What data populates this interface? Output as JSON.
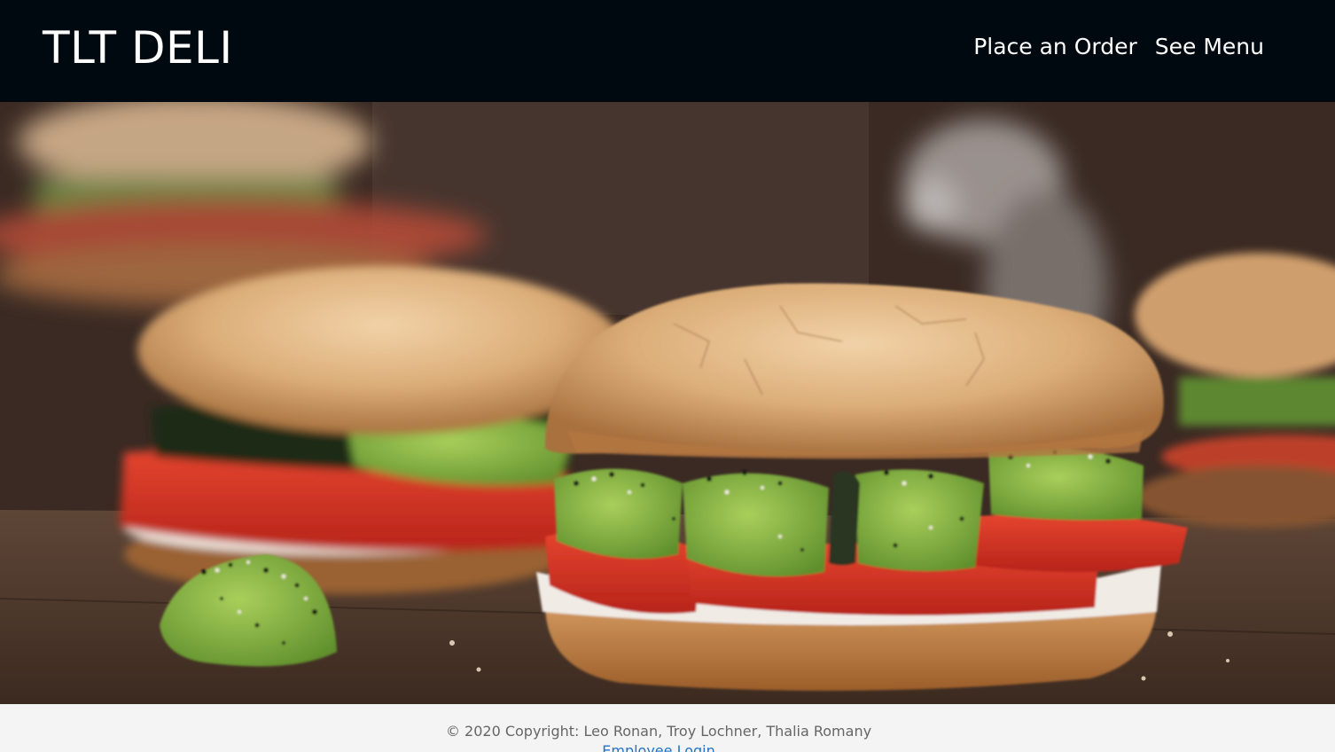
{
  "header": {
    "brand": "TLT DELI",
    "nav": [
      {
        "label": "Place an Order"
      },
      {
        "label": "See Menu"
      }
    ]
  },
  "hero": {
    "alt": "Bagel sandwiches with cream cheese, tomato and avocado"
  },
  "footer": {
    "copyright": "© 2020 Copyright: Leo Ronan, Troy Lochner, Thalia Romany",
    "employee_login": "Employee Login"
  },
  "colors": {
    "navbar_bg": "#010910",
    "nav_text": "#ffffff",
    "footer_bg": "#f4f4f4",
    "footer_text": "#666666",
    "link": "#2574c4"
  }
}
